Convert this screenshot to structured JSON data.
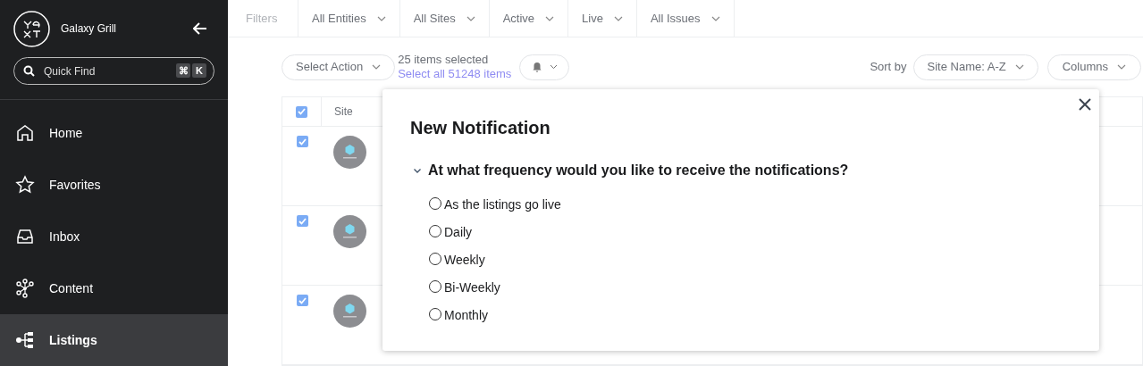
{
  "sidebar": {
    "brand": "Galaxy Grill",
    "quick_find": {
      "placeholder": "Quick Find",
      "keys": [
        "⌘",
        "K"
      ]
    },
    "items": [
      {
        "label": "Home",
        "kind": "home",
        "selected": false
      },
      {
        "label": "Favorites",
        "kind": "star",
        "selected": false
      },
      {
        "label": "Inbox",
        "kind": "inbox",
        "selected": false
      },
      {
        "label": "Content",
        "kind": "content",
        "selected": false
      },
      {
        "label": "Listings",
        "kind": "listings",
        "selected": true
      }
    ]
  },
  "filters": {
    "label": "Filters",
    "items": [
      "All Entities",
      "All Sites",
      "Active",
      "Live",
      "All Issues"
    ]
  },
  "toolbar": {
    "action": "Select Action",
    "selected_count": "25 items selected",
    "select_all": "Select all 51248 items",
    "sort_label": "Sort by",
    "sort_value": "Site Name: A-Z",
    "columns": "Columns"
  },
  "table": {
    "header_checked": true,
    "columns": [
      "Site"
    ],
    "rows": [
      {
        "checked": true
      },
      {
        "checked": true
      },
      {
        "checked": true
      }
    ]
  },
  "dialog": {
    "title": "New Notification",
    "question": "At what frequency would you like to receive the notifications?",
    "expanded": true,
    "options": [
      {
        "label": "As the listings go live",
        "selected": false
      },
      {
        "label": "Daily",
        "selected": false
      },
      {
        "label": "Weekly",
        "selected": false
      },
      {
        "label": "Bi-Weekly",
        "selected": false
      },
      {
        "label": "Monthly",
        "selected": false
      }
    ]
  }
}
